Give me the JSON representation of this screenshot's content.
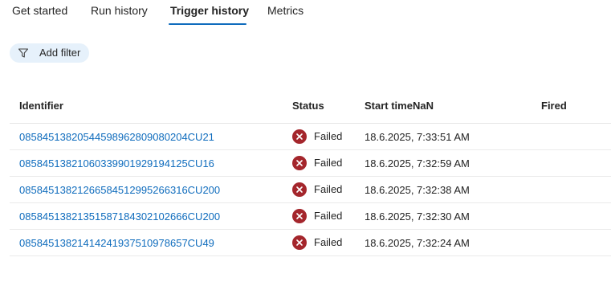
{
  "tabs": [
    {
      "label": "Get started"
    },
    {
      "label": "Run history"
    },
    {
      "label": "Trigger history",
      "active": true
    },
    {
      "label": "Metrics"
    }
  ],
  "filter": {
    "label": "Add filter",
    "icon": "filter-icon"
  },
  "table": {
    "columns": [
      "Identifier",
      "Status",
      "Start timeNaN",
      "Fired"
    ],
    "rows": [
      {
        "id": "08584513820544598962809080204CU21",
        "status": "Failed",
        "start": "18.6.2025, 7:33:51 AM",
        "fired": ""
      },
      {
        "id": "08584513821060339901929194125CU16",
        "status": "Failed",
        "start": "18.6.2025, 7:32:59 AM",
        "fired": ""
      },
      {
        "id": "08584513821266584512995266316CU200",
        "status": "Failed",
        "start": "18.6.2025, 7:32:38 AM",
        "fired": ""
      },
      {
        "id": "08584513821351587184302102666CU200",
        "status": "Failed",
        "start": "18.6.2025, 7:32:30 AM",
        "fired": ""
      },
      {
        "id": "08584513821414241937510978657CU49",
        "status": "Failed",
        "start": "18.6.2025, 7:32:24 AM",
        "fired": ""
      }
    ]
  },
  "colors": {
    "accent": "#0f6cbd",
    "failed": "#a4262c",
    "pill": "#e6f1fb"
  }
}
